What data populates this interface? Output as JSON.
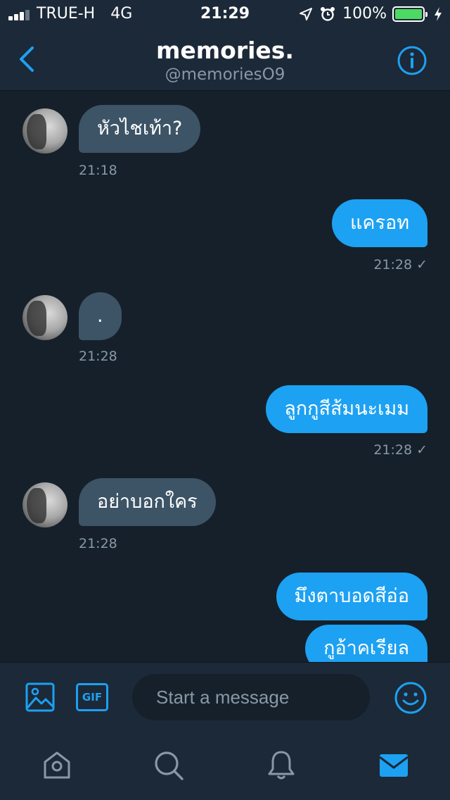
{
  "status_bar": {
    "carrier": "TRUE-H",
    "network": "4G",
    "time": "21:29",
    "battery": "100%",
    "battery_fraction": 1.0
  },
  "header": {
    "title": "memories.",
    "handle": "@memoriesO9"
  },
  "messages": [
    {
      "direction": "in",
      "text": "หัวไชเท้า?",
      "time": "21:18"
    },
    {
      "direction": "out",
      "text": "แครอท",
      "time": "21:28",
      "check": "✓"
    },
    {
      "direction": "in",
      "text": ".",
      "time": "21:28"
    },
    {
      "direction": "out",
      "text": "ลูกกูสีส้มนะเมม",
      "time": "21:28",
      "check": "✓"
    },
    {
      "direction": "in",
      "text": "อย่าบอกใคร",
      "time": "21:28"
    },
    {
      "direction": "out",
      "text": "มึงตาบอดสีอ่อ"
    },
    {
      "direction": "out",
      "text": "กูอ้าคเรียล"
    }
  ],
  "composer": {
    "gif_label": "GIF",
    "placeholder": "Start a message"
  },
  "icons": {
    "back": "chevron-left-icon",
    "info": "info-icon",
    "media": "image-icon",
    "emoji": "smiley-icon",
    "tabs": [
      "home-icon",
      "search-icon",
      "bell-icon",
      "mail-icon"
    ]
  },
  "colors": {
    "background": "#15202b",
    "bar": "#1c2938",
    "accent": "#1da1f2",
    "incoming_bubble": "#3d5466",
    "muted_text": "#8899a6"
  }
}
